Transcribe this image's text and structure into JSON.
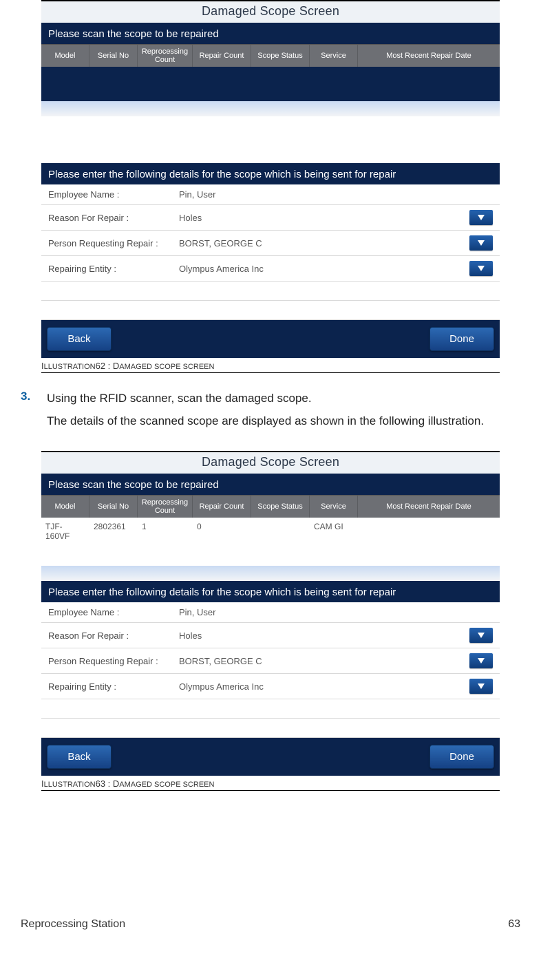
{
  "screen": {
    "title": "Damaged Scope Screen",
    "scan_prompt": "Please scan the scope to be repaired",
    "details_prompt": "Please enter the following details for the scope which is being sent for repair",
    "headers": {
      "model": "Model",
      "serial": "Serial No",
      "reproc": "Reprocessing Count",
      "repair": "Repair Count",
      "status": "Scope Status",
      "service": "Service",
      "date": "Most Recent Repair Date"
    },
    "form": {
      "employee_label": "Employee Name :",
      "employee_value": "Pin, User",
      "reason_label": "Reason For Repair :",
      "reason_value": "Holes",
      "requester_label": "Person Requesting Repair :",
      "requester_value": "BORST, GEORGE C",
      "entity_label": "Repairing Entity :",
      "entity_value": "Olympus America Inc"
    },
    "buttons": {
      "back": "Back",
      "done": "Done"
    }
  },
  "scope2": {
    "model": "TJF-160VF",
    "serial": "2802361",
    "reproc": "1",
    "repair": "0",
    "status": "",
    "service": "CAM GI",
    "date": ""
  },
  "captions": {
    "c62_pre": "I",
    "c62_word": "LLUSTRATION",
    "c62_num": " 62 : D",
    "c62_rest": "AMAGED SCOPE SCREEN",
    "c63_pre": "I",
    "c63_word": "LLUSTRATION",
    "c63_num": " 63 : D",
    "c63_rest": "AMAGED SCOPE SCREEN"
  },
  "step": {
    "num": "3.",
    "line1": "Using the RFID scanner, scan the damaged scope.",
    "line2": "The details of the scanned scope are displayed as shown in the following illustration."
  },
  "footer": {
    "left": "Reprocessing Station",
    "right": "63"
  }
}
